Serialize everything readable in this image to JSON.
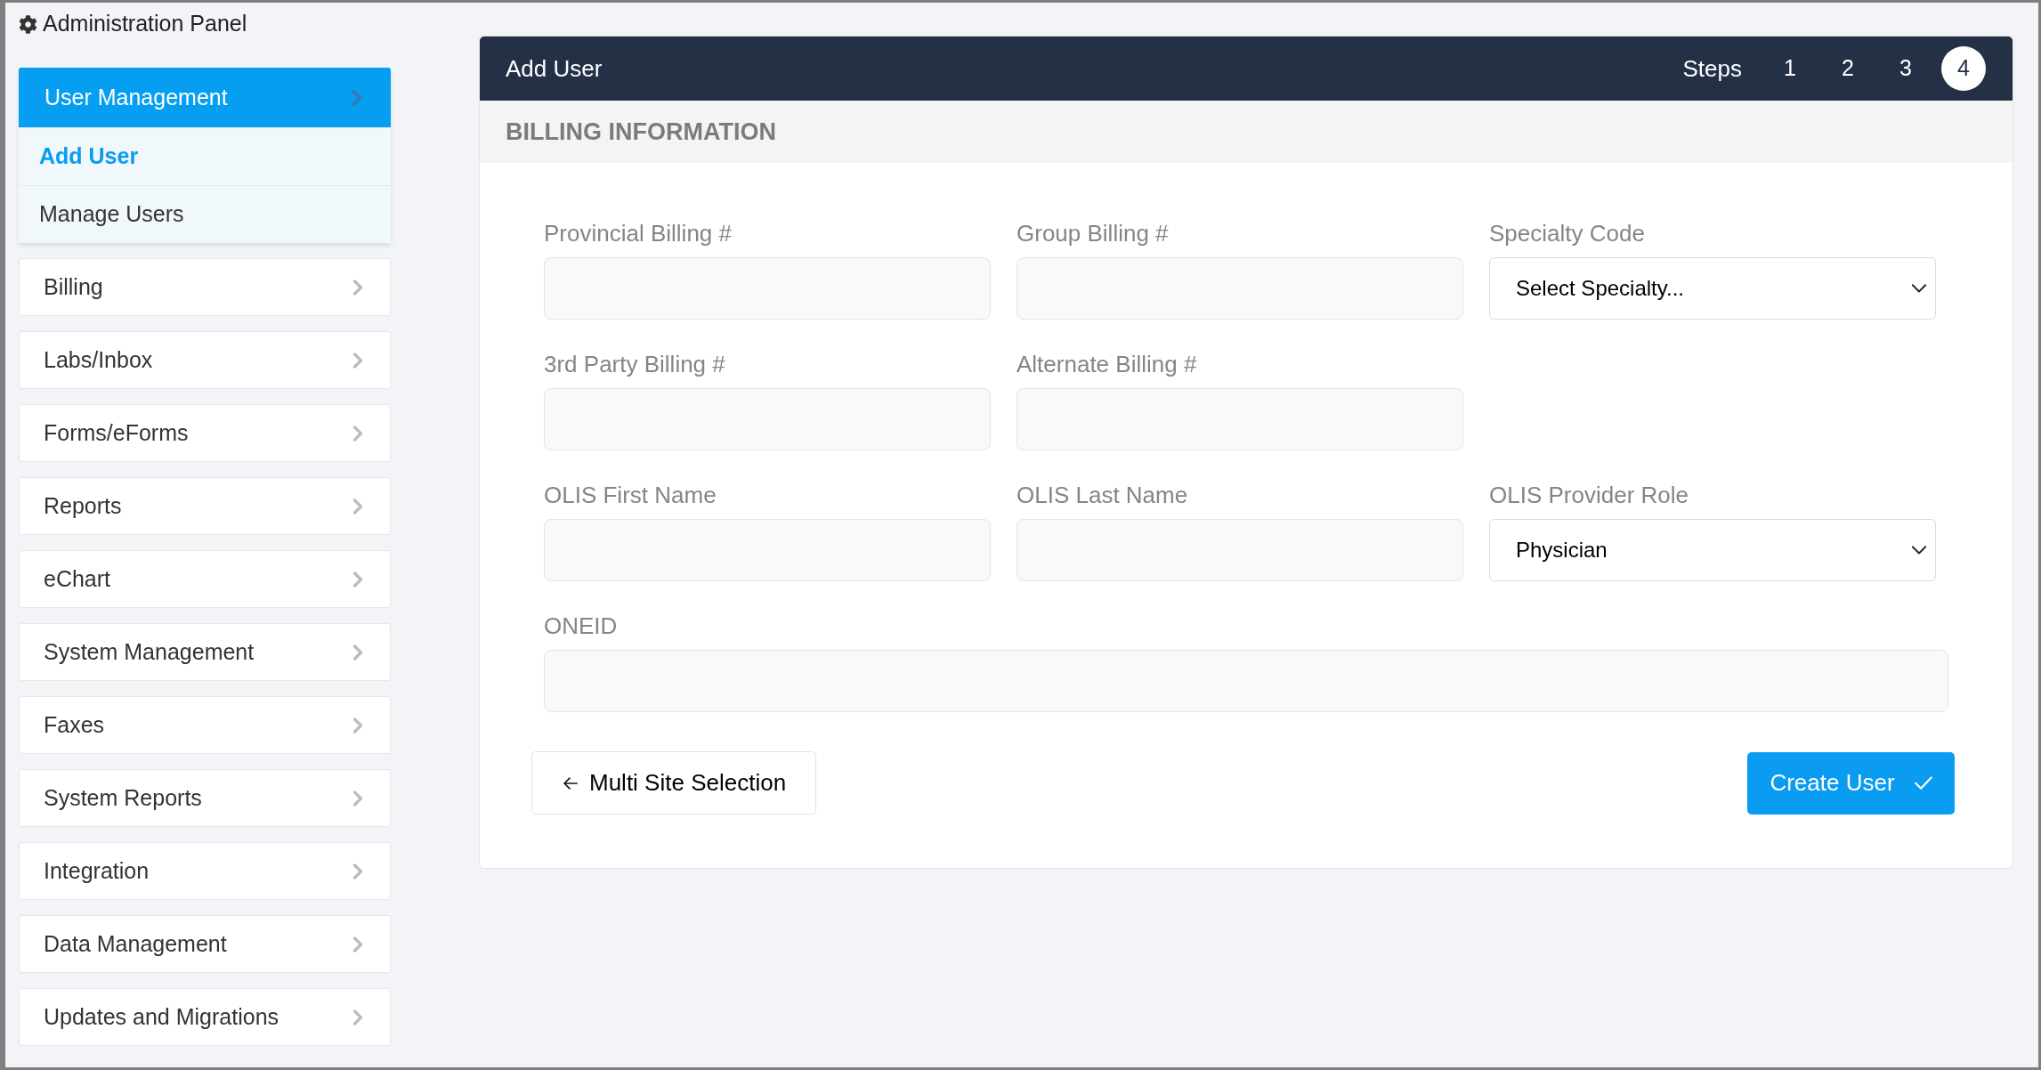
{
  "app_title": "Administration Panel",
  "sidebar": {
    "items": [
      {
        "label": "User Management",
        "expanded": true,
        "children": [
          {
            "label": "Add User",
            "selected": true
          },
          {
            "label": "Manage Users",
            "selected": false
          }
        ]
      },
      {
        "label": "Billing",
        "expanded": false
      },
      {
        "label": "Labs/Inbox",
        "expanded": false
      },
      {
        "label": "Forms/eForms",
        "expanded": false
      },
      {
        "label": "Reports",
        "expanded": false
      },
      {
        "label": "eChart",
        "expanded": false
      },
      {
        "label": "System Management",
        "expanded": false
      },
      {
        "label": "Faxes",
        "expanded": false
      },
      {
        "label": "System Reports",
        "expanded": false
      },
      {
        "label": "Integration",
        "expanded": false
      },
      {
        "label": "Data Management",
        "expanded": false
      },
      {
        "label": "Updates and Migrations",
        "expanded": false
      }
    ]
  },
  "panel": {
    "title": "Add User",
    "steps_label": "Steps",
    "steps": [
      {
        "label": "1",
        "selected": false
      },
      {
        "label": "2",
        "selected": false
      },
      {
        "label": "3",
        "selected": false
      },
      {
        "label": "4",
        "selected": true
      }
    ],
    "section_title": "BILLING INFORMATION",
    "form": {
      "rows": [
        [
          {
            "label": "Provincial Billing #",
            "kind": "text"
          },
          {
            "label": "Group Billing #",
            "kind": "text"
          },
          {
            "label": "Specialty Code",
            "kind": "select",
            "value": "Select Specialty..."
          }
        ],
        [
          {
            "label": "3rd Party Billing #",
            "kind": "text"
          },
          {
            "label": "Alternate Billing #",
            "kind": "text"
          }
        ],
        [
          {
            "label": "OLIS First Name",
            "kind": "text"
          },
          {
            "label": "OLIS Last Name",
            "kind": "text"
          },
          {
            "label": "OLIS Provider Role",
            "kind": "select",
            "value": "Physician"
          }
        ],
        [
          {
            "label": "ONEID",
            "kind": "text"
          }
        ]
      ]
    },
    "actions": [
      {
        "label": "Multi Site Selection",
        "kind": "back"
      },
      {
        "label": "Create User",
        "kind": "submit"
      }
    ]
  }
}
